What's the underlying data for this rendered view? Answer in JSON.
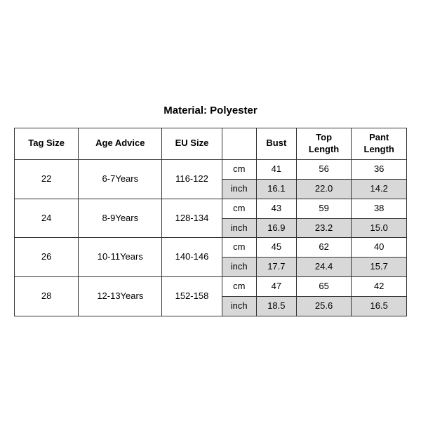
{
  "title": "Material: Polyester",
  "headers": {
    "tag_size": "Tag Size",
    "age_advice": "Age Advice",
    "eu_size": "EU Size",
    "unit": "",
    "bust": "Bust",
    "top_length": "Top\nLength",
    "pant_length": "Pant\nLength"
  },
  "rows": [
    {
      "tag_size": "22",
      "age_advice": "6-7Years",
      "eu_size": "116-122",
      "cm": {
        "bust": "41",
        "top_length": "56",
        "pant_length": "36"
      },
      "inch": {
        "bust": "16.1",
        "top_length": "22.0",
        "pant_length": "14.2"
      }
    },
    {
      "tag_size": "24",
      "age_advice": "8-9Years",
      "eu_size": "128-134",
      "cm": {
        "bust": "43",
        "top_length": "59",
        "pant_length": "38"
      },
      "inch": {
        "bust": "16.9",
        "top_length": "23.2",
        "pant_length": "15.0"
      }
    },
    {
      "tag_size": "26",
      "age_advice": "10-11Years",
      "eu_size": "140-146",
      "cm": {
        "bust": "45",
        "top_length": "62",
        "pant_length": "40"
      },
      "inch": {
        "bust": "17.7",
        "top_length": "24.4",
        "pant_length": "15.7"
      }
    },
    {
      "tag_size": "28",
      "age_advice": "12-13Years",
      "eu_size": "152-158",
      "cm": {
        "bust": "47",
        "top_length": "65",
        "pant_length": "42"
      },
      "inch": {
        "bust": "18.5",
        "top_length": "25.6",
        "pant_length": "16.5"
      }
    }
  ],
  "units": {
    "cm": "cm",
    "inch": "inch"
  }
}
